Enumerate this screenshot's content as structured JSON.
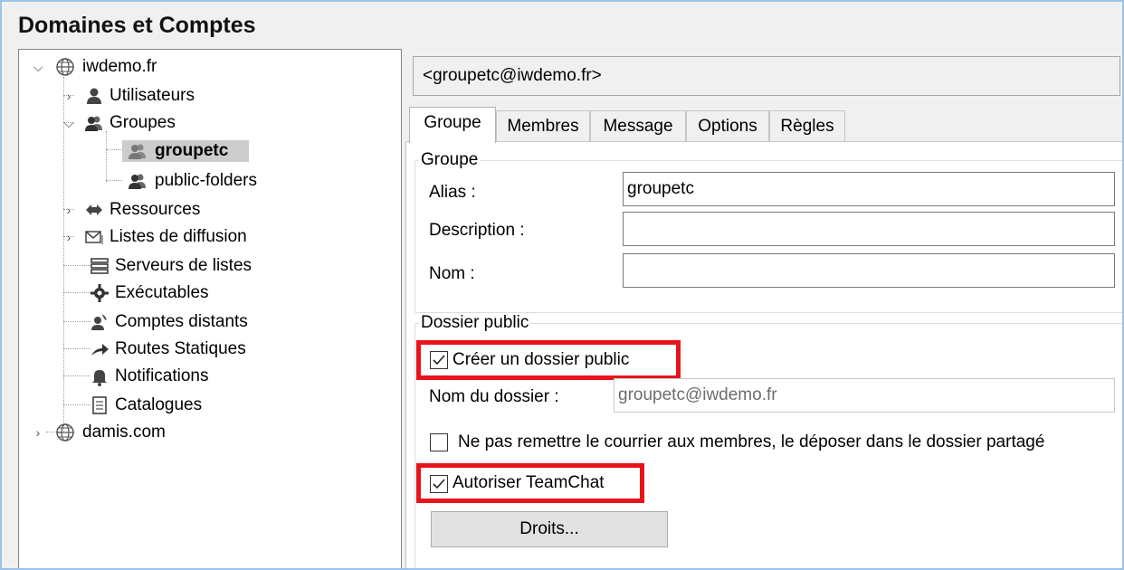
{
  "title": "Domaines et Comptes",
  "tree": {
    "domain1": "iwdemo.fr",
    "utilisateurs": "Utilisateurs",
    "groupes": "Groupes",
    "groupetc": "groupetc",
    "public_folders": "public-folders",
    "ressources": "Ressources",
    "listes": "Listes de diffusion",
    "serveurs": "Serveurs de listes",
    "executables": "Exécutables",
    "comptes": "Comptes distants",
    "routes": "Routes Statiques",
    "notifications": "Notifications",
    "catalogues": "Catalogues",
    "domain2": "damis.com"
  },
  "address": "<groupetc@iwdemo.fr>",
  "tabs": [
    "Groupe",
    "Membres",
    "Message",
    "Options",
    "Règles"
  ],
  "groupe": {
    "legend": "Groupe",
    "alias_label": "Alias :",
    "alias_value": "groupetc",
    "description_label": "Description :",
    "description_value": "",
    "nom_label": "Nom :",
    "nom_value": ""
  },
  "dossier": {
    "legend": "Dossier public",
    "creer_label": "Créer un dossier public",
    "creer_checked": true,
    "nom_dossier_label": "Nom du dossier :",
    "nom_dossier_value": "groupetc@iwdemo.fr",
    "ne_pas_label": "Ne pas remettre le courrier aux membres, le déposer dans le dossier partagé",
    "ne_pas_checked": false,
    "teamchat_label": "Autoriser TeamChat",
    "teamchat_checked": true,
    "droits_button": "Droits..."
  },
  "colors": {
    "highlight": "#e8141b",
    "frame": "#9cc3e8"
  }
}
